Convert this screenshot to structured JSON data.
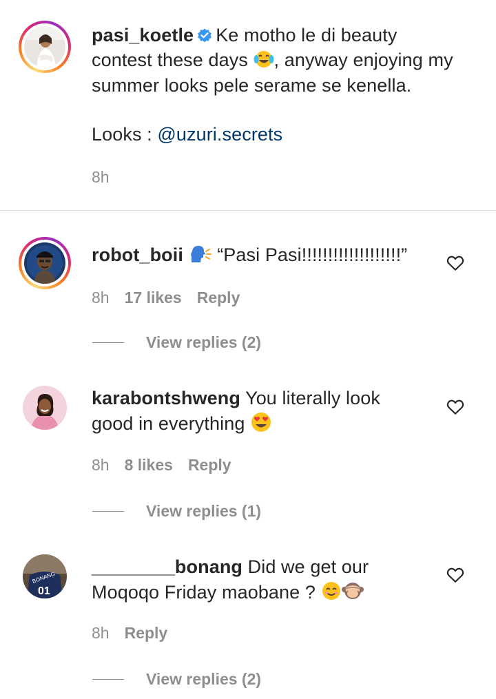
{
  "caption": {
    "username": "pasi_koetle",
    "text_line1": "Ke motho le di beauty",
    "text_line2_a": "contest these days",
    "text_line2_b": ", anyway enjoying my",
    "text_line3": "summer looks pele serame se kenella.",
    "looks_label": "Looks :",
    "looks_link": "@uzuri.secrets",
    "time": "8h"
  },
  "comments": [
    {
      "username": "robot_boii",
      "text": "“Pasi Pasi!!!!!!!!!!!!!!!!!!!”",
      "time": "8h",
      "likes": "17 likes",
      "reply": "Reply",
      "view_replies": "View replies (2)"
    },
    {
      "username": "karabontshweng",
      "text_line1": "You literally look",
      "text_line2": "good in everything",
      "time": "8h",
      "likes": "8 likes",
      "reply": "Reply",
      "view_replies": "View replies (1)"
    },
    {
      "username": "________bonang",
      "text_line1": "Did we get our",
      "text_line2": "Moqoqo Friday maobane ?",
      "time": "8h",
      "reply": "Reply",
      "view_replies": "View replies (2)"
    }
  ],
  "icons": {
    "verified": "verified-badge-icon",
    "heart": "heart-outline-icon"
  },
  "colors": {
    "link": "#00376b",
    "meta": "#8e8e8e",
    "verified": "#3897f0"
  }
}
